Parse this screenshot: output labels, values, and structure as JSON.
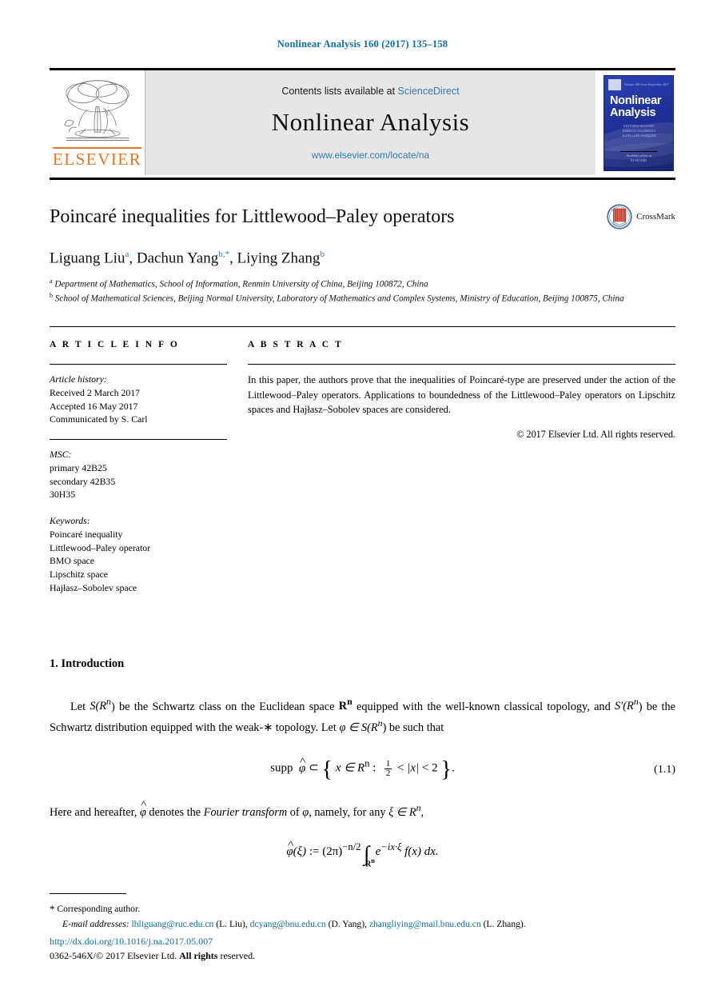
{
  "running_head": "Nonlinear Analysis 160 (2017) 135–158",
  "masthead": {
    "publisher_logo_name": "ELSEVIER",
    "contents_prefix": "Contents lists available at",
    "contents_link": "ScienceDirect",
    "journal_name": "Nonlinear Analysis",
    "journal_url": "www.elsevier.com/locate/na",
    "cover": {
      "title_line1": "Nonlinear",
      "title_line2": "Analysis",
      "sub_line1": "EDITORS-IN-CHIEF",
      "sub_line2": "ENRICO VALDINOCI",
      "sub_line3": "JUAN LUIS VAZQUEZ",
      "foot_line1": "Available online at",
      "foot_line2": "ELSEVIER",
      "head_left": "Volume 160",
      "head_mid": "Issue",
      "head_right": "September 2017"
    }
  },
  "article": {
    "title": "Poincaré inequalities for Littlewood–Paley operators",
    "crossmark_label": "CrossMark",
    "authors": [
      {
        "name": "Liguang Liu",
        "sup": "a"
      },
      {
        "name": "Dachun Yang",
        "sup": "b,*"
      },
      {
        "name": "Liying Zhang",
        "sup": "b"
      }
    ],
    "affiliations": [
      {
        "mark": "a",
        "text": "Department of Mathematics, School of Information, Renmin University of China, Beijing 100872, China"
      },
      {
        "mark": "b",
        "text": "School of Mathematical Sciences, Beijing Normal University, Laboratory of Mathematics and Complex Systems, Ministry of Education, Beijing 100875, China"
      }
    ]
  },
  "info": {
    "heading": "A R T I C L E   I N F O",
    "history_label": "Article history:",
    "history": [
      "Received 2 March 2017",
      "Accepted 16 May 2017",
      "Communicated by S. Carl"
    ],
    "msc_label": "MSC:",
    "msc": [
      "primary 42B25",
      "secondary 42B35",
      "30H35"
    ],
    "keywords_label": "Keywords:",
    "keywords": [
      "Poincaré inequality",
      "Littlewood–Paley operator",
      "BMO space",
      "Lipschitz space",
      "Hajłasz–Sobolev space"
    ]
  },
  "abstract": {
    "heading": "A B S T R A C T",
    "text": "In this paper, the authors prove that the inequalities of Poincaré-type are preserved under the action of the Littlewood–Paley operators. Applications to boundedness of the Littlewood–Paley operators on Lipschitz spaces and Hajłasz–Sobolev spaces are considered.",
    "copyright": "© 2017 Elsevier Ltd. All rights reserved."
  },
  "body": {
    "section_heading": "1. Introduction",
    "paragraph1_parts": {
      "p1": "Let ",
      "m1": "S(R",
      "m1sup": "n",
      "p2": ") be the Schwartz class on the Euclidean space ",
      "m2": "R",
      "m2sup": "n",
      "p3": " equipped with the well-known classical topology, and ",
      "m3": "S′(R",
      "m3sup": "n",
      "p4": ") be the Schwartz distribution equipped with the weak-∗ topology. Let ",
      "m4": "φ ∈ S(R",
      "m4sup": "n",
      "p5": ") be such that"
    },
    "equation_1_1": {
      "lhs": "supp",
      "phi": "φ",
      "subset": "⊂",
      "set_x": "x ∈ R",
      "set_sup": "n",
      "colon": ":",
      "frac_num": "1",
      "frac_den": "2",
      "lt1": "<",
      "absx": "|x|",
      "lt2": "<",
      "two": "2",
      "period": ".",
      "number": "(1.1)"
    },
    "paragraph2_parts": {
      "p1": "Here and hereafter, ",
      "phi": "φ",
      "p2": " denotes the ",
      "em": "Fourier transform",
      "p3": " of ",
      "phi2": "φ",
      "p4": ", namely, for any ",
      "xi": "ξ ∈ R",
      "xisup": "n",
      "p5": ","
    },
    "equation_2": {
      "lhs_phi": "φ",
      "lhs_arg": "(ξ)",
      "assign": ":=",
      "factor": "(2π)",
      "factor_sup": "−n/2",
      "integral_sub": "R",
      "integral_sub_sup": "n",
      "kernel": "e",
      "kernel_sup": "−ix·ξ",
      "fx": "f(x)",
      "dx": "dx."
    }
  },
  "footnotes": {
    "corresponding_mark": "*",
    "corresponding_text": "Corresponding author.",
    "email_label": "E-mail addresses:",
    "emails": [
      {
        "address": "lhliguang@ruc.edu.cn",
        "person": "(L. Liu)"
      },
      {
        "address": "dcyang@bnu.edu.cn",
        "person": "(D. Yang)"
      },
      {
        "address": "zhangliying@mail.bnu.edu.cn",
        "person": "(L. Zhang)."
      }
    ]
  },
  "bottom": {
    "doi": "http://dx.doi.org/10.1016/j.na.2017.05.007",
    "issn_prefix": "0362-546X/",
    "issn_copy": "© 2017 Elsevier Ltd. ",
    "issn_rights": "All rights",
    "issn_tail": " reserved."
  },
  "colors": {
    "link_blue": "#0b6ea8",
    "elsevier_orange": "#E87722",
    "cover_blue": "#1f3099",
    "masthead_grey": "#e6e6e6"
  }
}
